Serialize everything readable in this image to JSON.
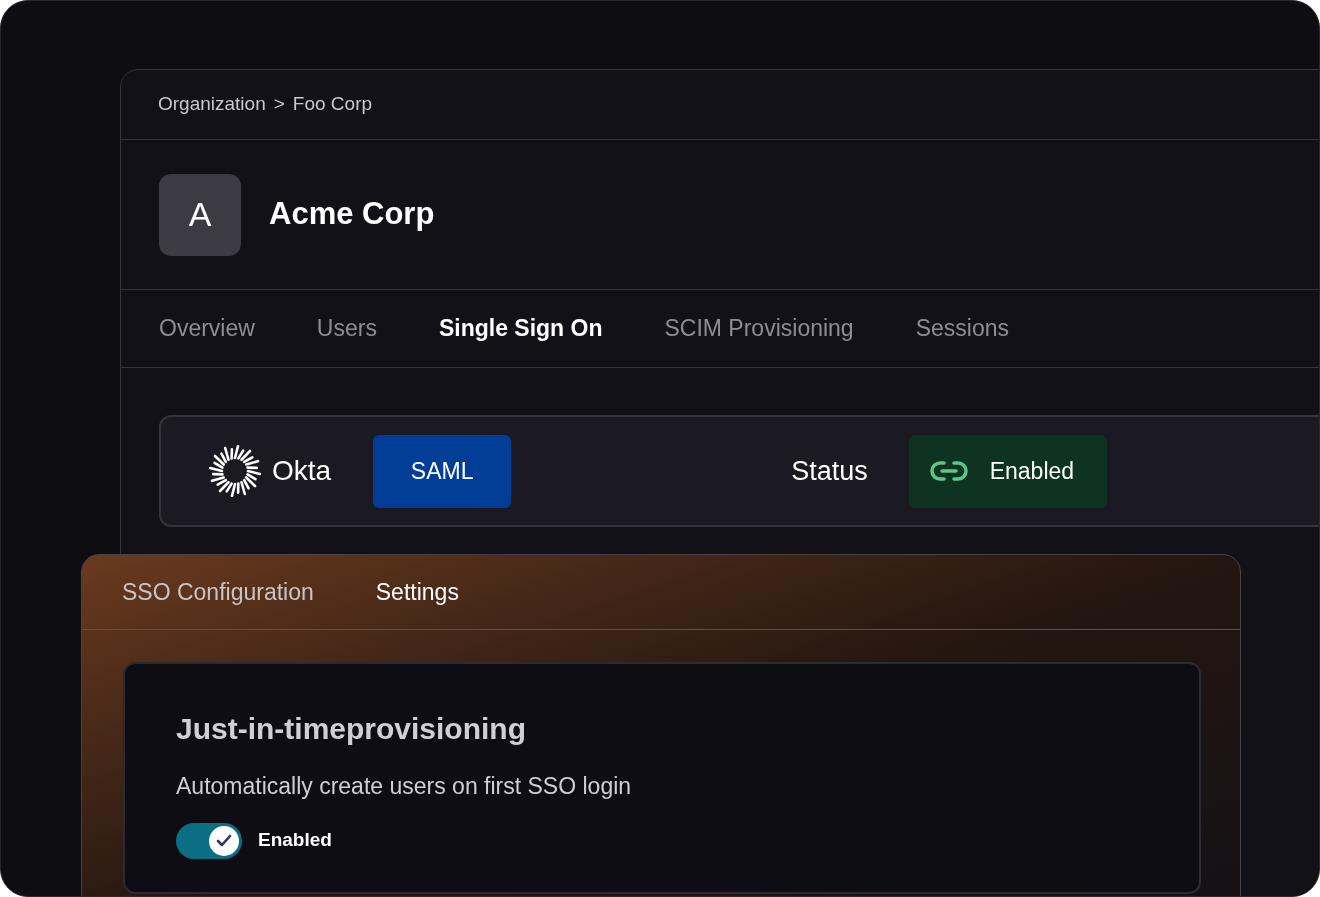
{
  "breadcrumb": {
    "items": [
      "Organization",
      "Foo Corp"
    ],
    "separator": ">"
  },
  "organization": {
    "avatar_letter": "A",
    "name": "Acme Corp"
  },
  "tabs": [
    {
      "label": "Overview",
      "selected": false
    },
    {
      "label": "Users",
      "selected": false
    },
    {
      "label": "Single Sign On",
      "selected": true
    },
    {
      "label": "SCIM Provisioning",
      "selected": false
    },
    {
      "label": "Sessions",
      "selected": false
    }
  ],
  "connection": {
    "provider": "Okta",
    "protocol": "SAML",
    "status_label": "Status",
    "status": "Enabled",
    "enabled": true
  },
  "settings_panel": {
    "tabs": [
      {
        "label": "SSO Configuration",
        "selected": false
      },
      {
        "label": "Settings",
        "selected": true
      }
    ],
    "section": {
      "title": "Just-in-timeprovisioning",
      "description": "Automatically create users on first SSO login",
      "toggle": {
        "on": true,
        "label": "Enabled"
      }
    }
  }
}
